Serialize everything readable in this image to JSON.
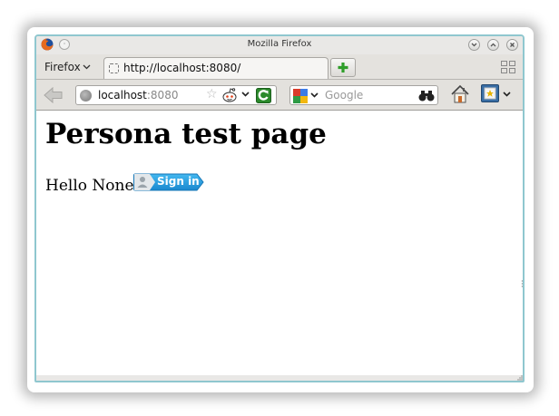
{
  "window": {
    "title": "Mozilla Firefox",
    "frame_color": "#8fc7cf"
  },
  "tabbar": {
    "firefox_menu_label": "Firefox",
    "tabs": [
      {
        "title": "http://localhost:8080/",
        "favicon": "blank-page-icon"
      }
    ],
    "new_tab_icon": "plus-icon",
    "tab_list_icon": "tab-grid-icon"
  },
  "navbar": {
    "url_host": "localhost",
    "url_port": ":8080",
    "search_placeholder": "Google",
    "icons": [
      "back-arrow-icon",
      "site-identity-icon",
      "bookmark-star-icon",
      "reddit-alien-icon",
      "dropdown-icon",
      "reload-icon",
      "google-engine-icon",
      "binoculars-icon",
      "home-icon",
      "addon-icon"
    ]
  },
  "content": {
    "heading": "Persona test page",
    "greeting": "Hello None",
    "signin_label": "Sign in",
    "signin_color": "#29a0e0"
  }
}
